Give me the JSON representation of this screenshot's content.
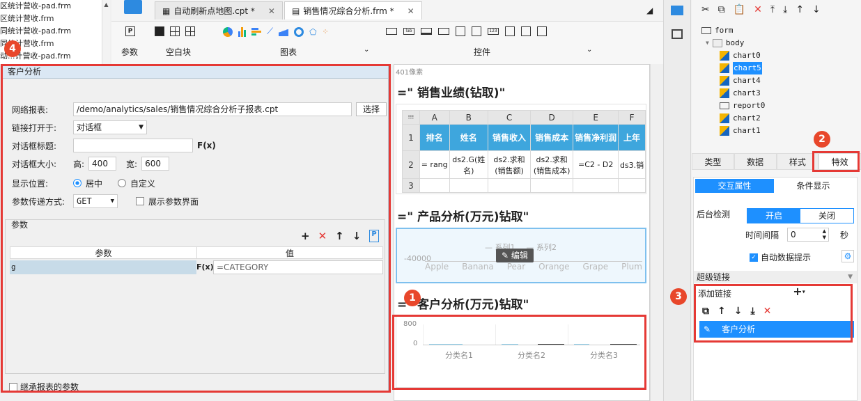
{
  "file_list": [
    "区统计营收-pad.frm",
    "区统计营收.frm",
    "同统计营收-pad.frm",
    "同统计营收.frm",
    "动...计营收-pad.frm"
  ],
  "toolbar": {
    "groups": {
      "param": "参数",
      "blank": "空白块",
      "chart": "图表",
      "widget": "控件"
    },
    "param_icon": "P"
  },
  "tabs": [
    {
      "label": "自动刷新点地图.cpt *"
    },
    {
      "label": "销售情况综合分析.frm *"
    }
  ],
  "dialog": {
    "title": "客户分析",
    "web_report_label": "网络报表:",
    "web_report_value": "/demo/analytics/sales/销售情况综合分析子报表.cpt",
    "select_button": "选择",
    "open_in_label": "链接打开于:",
    "open_in_value": "对话框",
    "dialog_title_label": "对话框标题:",
    "dialog_title_value": "",
    "size_label": "对话框大小:",
    "height_label": "高:",
    "height_value": "400",
    "width_label": "宽:",
    "width_value": "600",
    "position_label": "显示位置:",
    "pos_center": "居中",
    "pos_custom": "自定义",
    "method_label": "参数传递方式:",
    "method_value": "GET",
    "show_param_label": "展示参数界面",
    "param_section": "参数",
    "col_param": "参数",
    "col_value": "值",
    "param_rows": [
      {
        "name": "g",
        "value": "=CATEGORY"
      }
    ],
    "inherit_label": "继承报表的参数",
    "formula_icon": "F(x)"
  },
  "canvas": {
    "pixel_label": "401像素",
    "title1": "=\" 销售业绩(钻取)\"",
    "title2": "=\" 产品分析(万元)钻取\"",
    "title3": "=\" 客户分析(万元)钻取\"",
    "table_cols": [
      "A",
      "B",
      "C",
      "D",
      "E",
      "F"
    ],
    "table_header": [
      "排名",
      "姓名",
      "销售收入",
      "销售成本",
      "销售净利润",
      "上年"
    ],
    "table_row2": [
      "= rang",
      "ds2.G(姓名)",
      "ds2.求和(销售额)",
      "ds2.求和(销售成本)",
      "=C2 - D2",
      "ds3.销"
    ],
    "row_nums": [
      "1",
      "2",
      "3"
    ],
    "chart2_legend": [
      "系列1",
      "系列2"
    ],
    "chart2_value": "40000",
    "chart2_cats": [
      "Apple",
      "Banana",
      "Pear",
      "Orange",
      "Grape",
      "Plum"
    ],
    "edit_button": "编辑",
    "chart3_y": [
      "800",
      "0"
    ],
    "chart3_cats": [
      "分类名1",
      "分类名2",
      "分类名3"
    ]
  },
  "right": {
    "tree": [
      {
        "name": "form",
        "selected": false
      },
      {
        "name": "body",
        "selected": false
      },
      {
        "name": "chart0",
        "selected": false
      },
      {
        "name": "chart5",
        "selected": true
      },
      {
        "name": "chart4",
        "selected": false
      },
      {
        "name": "chart3",
        "selected": false
      },
      {
        "name": "report0",
        "selected": false
      },
      {
        "name": "chart2",
        "selected": false
      },
      {
        "name": "chart1",
        "selected": false
      }
    ],
    "prop_tabs": [
      "类型",
      "数据",
      "样式",
      "特效"
    ],
    "sub_tabs": [
      "交互属性",
      "条件显示"
    ],
    "backend_label": "后台检测",
    "on_label": "开启",
    "off_label": "关闭",
    "interval_label": "时间间隔",
    "interval_value": "0",
    "seconds": "秒",
    "auto_tip": "自动数据提示",
    "hyperlink_label": "超级链接",
    "add_link_label": "添加链接",
    "link_item": "客户分析"
  },
  "badges": [
    "1",
    "2",
    "3",
    "4"
  ],
  "colors": {
    "highlight_red": "#e53935",
    "accent_blue": "#1e90ff",
    "header_blue": "#3ea6dd"
  }
}
